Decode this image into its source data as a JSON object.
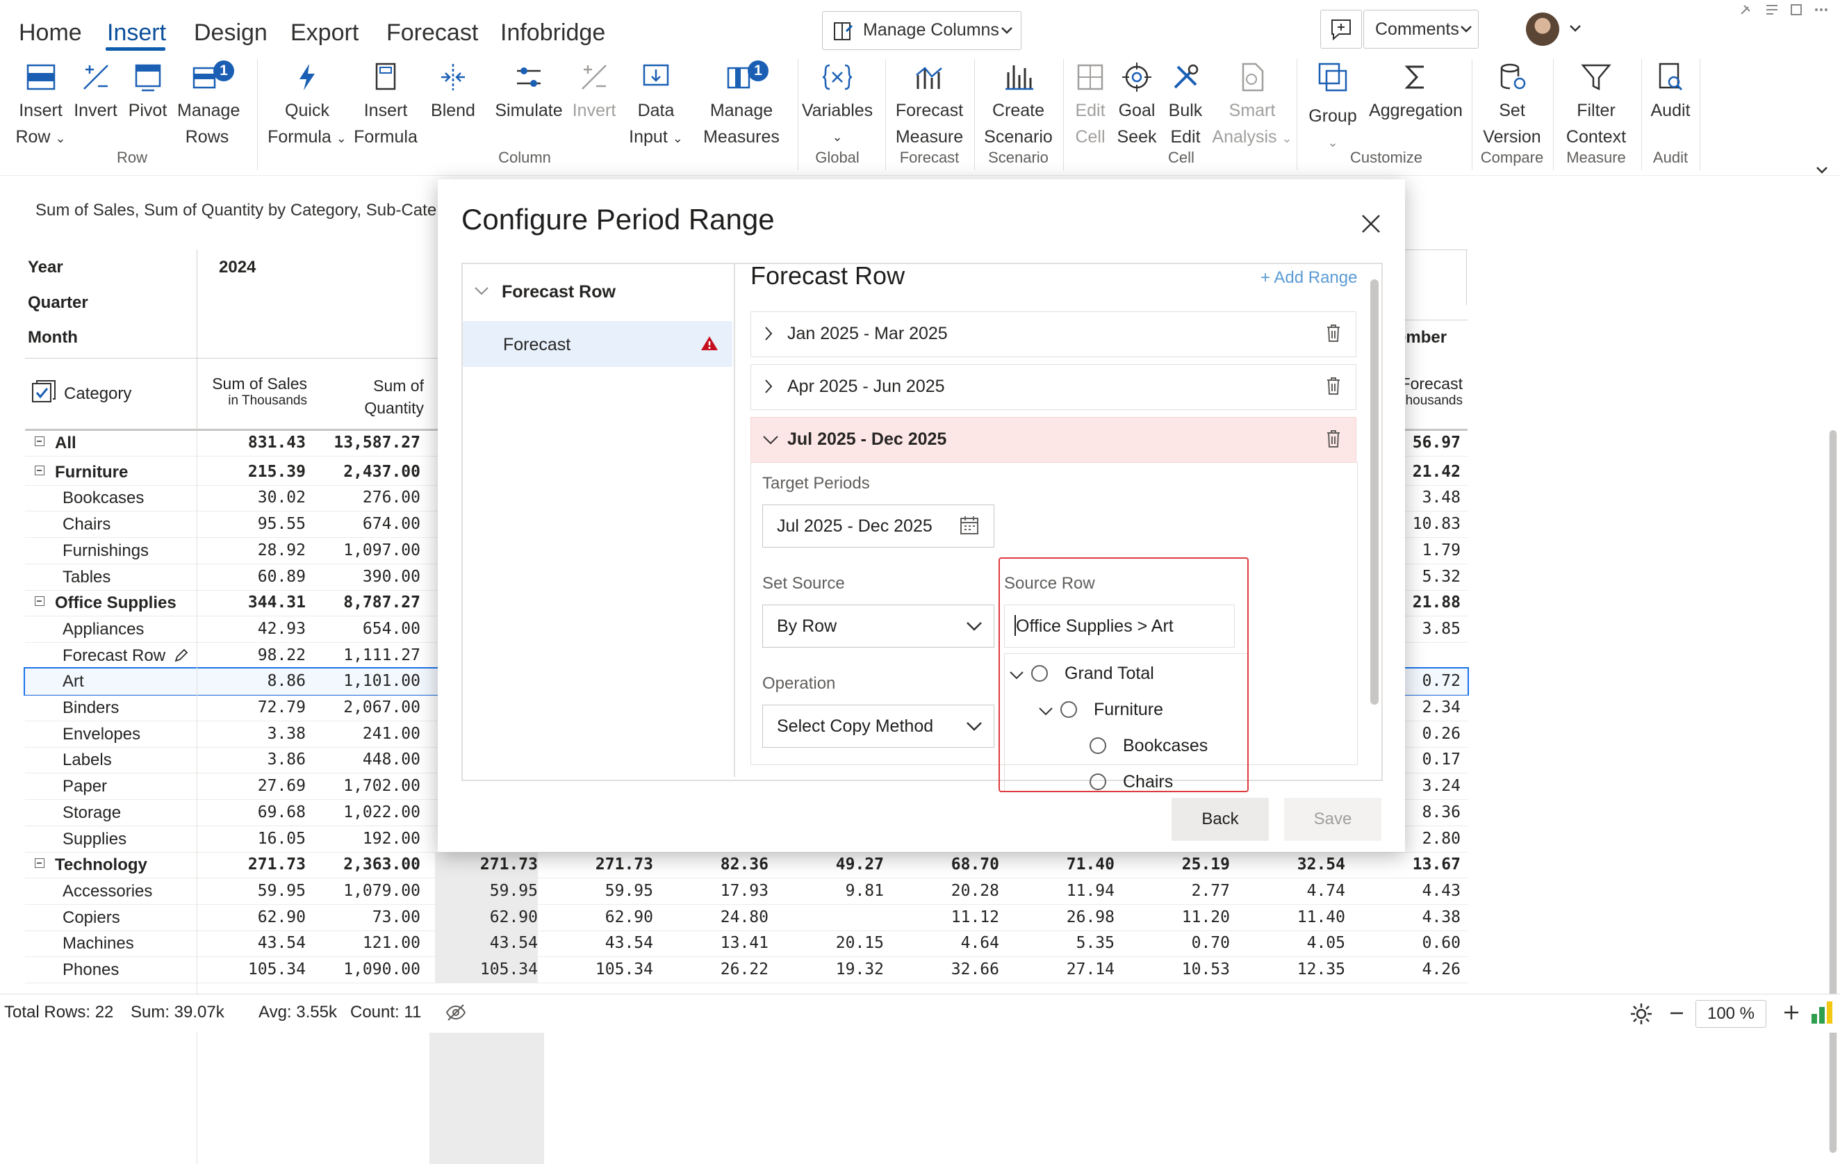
{
  "ribbon": {
    "tabs": [
      "Home",
      "Insert",
      "Design",
      "Export",
      "Forecast",
      "Infobridge"
    ],
    "active_tab": "Insert",
    "manage_columns": "Manage Columns",
    "comments": "Comments",
    "row_group": {
      "label": "Row",
      "insert_row": [
        "Insert",
        "Row"
      ],
      "invert": "Invert",
      "pivot": "Pivot",
      "manage_rows": [
        "Manage",
        "Rows"
      ],
      "manage_rows_badge": "1"
    },
    "column_group": {
      "label": "Column",
      "quick_formula": [
        "Quick",
        "Formula"
      ],
      "insert_formula": [
        "Insert",
        "Formula"
      ],
      "blend": "Blend",
      "simulate": "Simulate",
      "invert": "Invert",
      "data_input": [
        "Data",
        "Input"
      ],
      "manage_measures": [
        "Manage",
        "Measures"
      ],
      "manage_measures_badge": "1"
    },
    "global_group": {
      "label": "Global",
      "variables": "Variables"
    },
    "forecast_group": {
      "label": "Forecast",
      "forecast_measure": [
        "Forecast",
        "Measure"
      ]
    },
    "scenario_group": {
      "label": "Scenario",
      "create_scenario": [
        "Create",
        "Scenario"
      ]
    },
    "cell_group": {
      "label": "Cell",
      "edit_cell": [
        "Edit",
        "Cell"
      ],
      "goal_seek": [
        "Goal",
        "Seek"
      ],
      "bulk_edit": [
        "Bulk",
        "Edit"
      ],
      "smart_analysis": [
        "Smart",
        "Analysis"
      ]
    },
    "customize_group": {
      "label": "Customize",
      "group": "Group",
      "aggregation": "Aggregation"
    },
    "compare_group": {
      "label": "Compare",
      "set_version": [
        "Set",
        "Version"
      ]
    },
    "measure_group": {
      "label": "Measure",
      "filter_context": [
        "Filter",
        "Context"
      ]
    },
    "audit_group": {
      "label": "Audit",
      "audit": "Audit"
    }
  },
  "report": {
    "subtitle": "Sum of Sales, Sum of Quantity by Category, Sub-Cate",
    "header": {
      "year_label": "Year",
      "quarter_label": "Quarter",
      "month_label": "Month",
      "year_value": "2024",
      "category_label": "Category",
      "col1": [
        "Sum of Sales",
        "in Thousands"
      ],
      "col2": [
        "Sum of",
        "Quantity"
      ],
      "right_month": "ember",
      "right_col": [
        "Forecast",
        "housands"
      ]
    },
    "rows": [
      {
        "name": "All",
        "sales": "831.43",
        "qty": "13,587.27",
        "right": "56.97",
        "level": 0,
        "bold": true,
        "toggle": true
      },
      {
        "name": "Furniture",
        "sales": "215.39",
        "qty": "2,437.00",
        "right": "21.42",
        "level": 0,
        "bold": true,
        "toggle": true
      },
      {
        "name": "Bookcases",
        "sales": "30.02",
        "qty": "276.00",
        "right": "3.48",
        "level": 1
      },
      {
        "name": "Chairs",
        "sales": "95.55",
        "qty": "674.00",
        "right": "10.83",
        "level": 1
      },
      {
        "name": "Furnishings",
        "sales": "28.92",
        "qty": "1,097.00",
        "right": "1.79",
        "level": 1
      },
      {
        "name": "Tables",
        "sales": "60.89",
        "qty": "390.00",
        "right": "5.32",
        "level": 1
      },
      {
        "name": "Office Supplies",
        "sales": "344.31",
        "qty": "8,787.27",
        "right": "21.88",
        "level": 0,
        "bold": true,
        "toggle": true
      },
      {
        "name": "Appliances",
        "sales": "42.93",
        "qty": "654.00",
        "right": "3.85",
        "level": 1
      },
      {
        "name": "Forecast Row",
        "sales": "98.22",
        "qty": "1,111.27",
        "right": "",
        "level": 1,
        "edit": true
      },
      {
        "name": "Art",
        "sales": "8.86",
        "qty": "1,101.00",
        "right": "0.72",
        "level": 1,
        "selected": true
      },
      {
        "name": "Binders",
        "sales": "72.79",
        "qty": "2,067.00",
        "right": "2.34",
        "level": 1
      },
      {
        "name": "Envelopes",
        "sales": "3.38",
        "qty": "241.00",
        "right": "0.26",
        "level": 1
      },
      {
        "name": "Labels",
        "sales": "3.86",
        "qty": "448.00",
        "right": "0.17",
        "level": 1
      },
      {
        "name": "Paper",
        "sales": "27.69",
        "qty": "1,702.00",
        "right": "3.24",
        "level": 1
      },
      {
        "name": "Storage",
        "sales": "69.68",
        "qty": "1,022.00",
        "right": "8.36",
        "level": 1
      },
      {
        "name": "Supplies",
        "sales": "16.05",
        "qty": "192.00",
        "right": "2.80",
        "level": 1
      },
      {
        "name": "Technology",
        "sales": "271.73",
        "qty": "2,363.00",
        "right": "13.67",
        "level": 0,
        "bold": true,
        "toggle": true,
        "extra": [
          "271.73",
          "271.73",
          "82.36",
          "49.27",
          "68.70",
          "71.40",
          "25.19",
          "32.54"
        ]
      },
      {
        "name": "Accessories",
        "sales": "59.95",
        "qty": "1,079.00",
        "right": "4.43",
        "level": 1,
        "extra": [
          "59.95",
          "59.95",
          "17.93",
          "9.81",
          "20.28",
          "11.94",
          "2.77",
          "4.74"
        ]
      },
      {
        "name": "Copiers",
        "sales": "62.90",
        "qty": "73.00",
        "right": "4.38",
        "level": 1,
        "extra": [
          "62.90",
          "62.90",
          "24.80",
          "",
          "11.12",
          "26.98",
          "11.20",
          "11.40"
        ]
      },
      {
        "name": "Machines",
        "sales": "43.54",
        "qty": "121.00",
        "right": "0.60",
        "level": 1,
        "extra": [
          "43.54",
          "43.54",
          "13.41",
          "20.15",
          "4.64",
          "5.35",
          "0.70",
          "4.05"
        ]
      },
      {
        "name": "Phones",
        "sales": "105.34",
        "qty": "1,090.00",
        "right": "4.26",
        "level": 1,
        "extra": [
          "105.34",
          "105.34",
          "26.22",
          "19.32",
          "32.66",
          "27.14",
          "10.53",
          "12.35"
        ]
      }
    ]
  },
  "dialog": {
    "title": "Configure Period Range",
    "left_header": "Forecast Row",
    "left_item": "Forecast",
    "section_title": "Forecast Row",
    "add_range": "+ Add Range",
    "ranges": [
      "Jan 2025 - Mar 2025",
      "Apr 2025 - Jun 2025",
      "Jul 2025 - Dec 2025"
    ],
    "target_periods_label": "Target Periods",
    "target_periods_value": "Jul 2025 - Dec 2025",
    "set_source_label": "Set Source",
    "set_source_value": "By Row",
    "operation_label": "Operation",
    "operation_value": "Select Copy Method",
    "source_row_label": "Source Row",
    "source_row_value": "Office Supplies > Art",
    "tree": [
      "Grand Total",
      "Furniture",
      "Bookcases",
      "Chairs"
    ],
    "back": "Back",
    "save": "Save"
  },
  "status": {
    "total_rows": "Total Rows: 22",
    "sum": "Sum: 39.07k",
    "avg": "Avg: 3.55k",
    "count": "Count: 11",
    "zoom": "100 %"
  },
  "colors": {
    "accent": "#0b5cad",
    "warning": "#c50f1f",
    "selection": "#1a73e8",
    "highlight_row": "#fde7e6"
  }
}
